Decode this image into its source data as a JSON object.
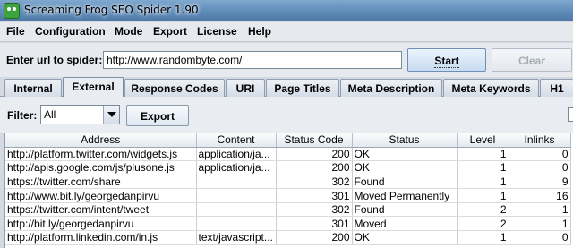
{
  "window": {
    "title": "Screaming Frog SEO Spider 1.90"
  },
  "menu": [
    "File",
    "Configuration",
    "Mode",
    "Export",
    "License",
    "Help"
  ],
  "url_bar": {
    "label": "Enter url to spider:",
    "value": "http://www.randombyte.com/",
    "start_label": "Start",
    "clear_label": "Clear"
  },
  "tabs": [
    "Internal",
    "External",
    "Response Codes",
    "URI",
    "Page Titles",
    "Meta Description",
    "Meta Keywords",
    "H1"
  ],
  "active_tab": "External",
  "filter": {
    "label": "Filter:",
    "value": "All",
    "export_label": "Export"
  },
  "table": {
    "columns": [
      "Address",
      "Content",
      "Status Code",
      "Status",
      "Level",
      "Inlinks"
    ],
    "rows": [
      [
        "http://platform.twitter.com/widgets.js",
        "application/ja...",
        "200",
        "OK",
        "1",
        "0"
      ],
      [
        "http://apis.google.com/js/plusone.js",
        "application/ja...",
        "200",
        "OK",
        "1",
        "0"
      ],
      [
        "https://twitter.com/share",
        "",
        "302",
        "Found",
        "1",
        "9"
      ],
      [
        "http://www.bit.ly/georgedanpirvu",
        "",
        "301",
        "Moved Permanently",
        "1",
        "16"
      ],
      [
        "https://twitter.com/intent/tweet",
        "",
        "302",
        "Found",
        "2",
        "1"
      ],
      [
        "http://bit.ly/georgedanpirvu",
        "",
        "301",
        "Moved",
        "2",
        "1"
      ],
      [
        "http://platform.linkedin.com/in.js",
        "text/javascript...",
        "200",
        "OK",
        "1",
        "0"
      ]
    ]
  }
}
